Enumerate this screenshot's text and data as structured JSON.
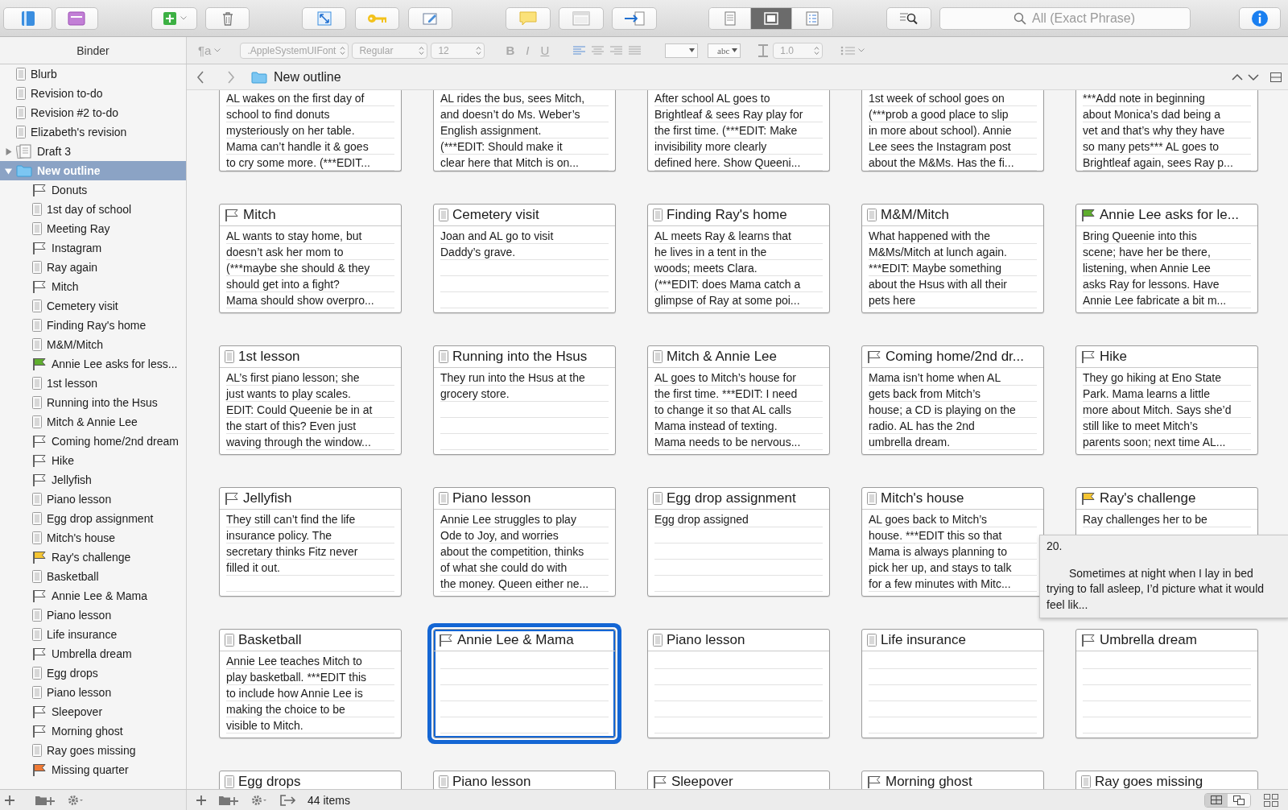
{
  "toolbar": {
    "view_modes": [
      {
        "selected": false
      },
      {
        "selected": true
      },
      {
        "selected": false
      }
    ],
    "search": {
      "placeholder": "All (Exact Phrase)"
    }
  },
  "format_bar": {
    "paragraph_style": "¶a",
    "font": ".AppleSystemUIFont",
    "typeface": "Regular",
    "size": "12",
    "bold": "B",
    "italic": "I",
    "underline": "U",
    "highlight": "abc",
    "line_spacing": "1.0"
  },
  "binder": {
    "title": "Binder",
    "items": [
      {
        "label": "Blurb",
        "kind": "doc",
        "selected": false
      },
      {
        "label": "Revision to-do",
        "kind": "doc",
        "selected": false
      },
      {
        "label": "Revision #2 to-do",
        "kind": "doc",
        "selected": false
      },
      {
        "label": "Elizabeth's revision",
        "kind": "doc",
        "selected": false
      },
      {
        "label": "Draft 3",
        "kind": "draft",
        "selected": false,
        "expanded": false
      },
      {
        "label": "New outline",
        "kind": "folder",
        "selected": true,
        "expanded": true,
        "children": [
          {
            "label": "Donuts",
            "kind": "flag",
            "selected": false
          },
          {
            "label": "1st day of school",
            "kind": "doc",
            "selected": false
          },
          {
            "label": "Meeting Ray",
            "kind": "doc",
            "selected": false
          },
          {
            "label": "Instagram",
            "kind": "flag",
            "selected": false
          },
          {
            "label": "Ray again",
            "kind": "doc",
            "selected": false
          },
          {
            "label": "Mitch",
            "kind": "flag",
            "selected": false
          },
          {
            "label": "Cemetery visit",
            "kind": "doc",
            "selected": false
          },
          {
            "label": "Finding Ray's home",
            "kind": "doc",
            "selected": false
          },
          {
            "label": "M&M/Mitch",
            "kind": "doc",
            "selected": false
          },
          {
            "label": "Annie Lee asks for less...",
            "kind": "flag",
            "color": "#5fae2e",
            "selected": false
          },
          {
            "label": "1st lesson",
            "kind": "doc",
            "selected": false
          },
          {
            "label": "Running into the Hsus",
            "kind": "doc",
            "selected": false
          },
          {
            "label": "Mitch & Annie Lee",
            "kind": "doc",
            "selected": false
          },
          {
            "label": "Coming home/2nd dream",
            "kind": "flag",
            "selected": false
          },
          {
            "label": "Hike",
            "kind": "flag",
            "selected": false
          },
          {
            "label": "Jellyfish",
            "kind": "flag",
            "selected": false
          },
          {
            "label": "Piano lesson",
            "kind": "doc",
            "selected": false
          },
          {
            "label": "Egg drop assignment",
            "kind": "doc",
            "selected": false
          },
          {
            "label": "Mitch's house",
            "kind": "doc",
            "selected": false
          },
          {
            "label": "Ray's challenge",
            "kind": "flag",
            "color": "#f5c533",
            "selected": false
          },
          {
            "label": "Basketball",
            "kind": "doc",
            "selected": false
          },
          {
            "label": "Annie Lee & Mama",
            "kind": "flag",
            "selected": false
          },
          {
            "label": "Piano lesson",
            "kind": "doc",
            "selected": false
          },
          {
            "label": "Life insurance",
            "kind": "doc",
            "selected": false
          },
          {
            "label": "Umbrella dream",
            "kind": "flag",
            "selected": false
          },
          {
            "label": "Egg drops",
            "kind": "doc",
            "selected": false
          },
          {
            "label": "Piano lesson",
            "kind": "doc",
            "selected": false
          },
          {
            "label": "Sleepover",
            "kind": "flag",
            "selected": false
          },
          {
            "label": "Morning ghost",
            "kind": "flag",
            "selected": false
          },
          {
            "label": "Ray goes missing",
            "kind": "doc",
            "selected": false
          },
          {
            "label": "Missing quarter",
            "kind": "flag",
            "color": "#f07a35",
            "selected": false
          }
        ]
      }
    ]
  },
  "header": {
    "title": "New outline"
  },
  "cards": [
    {
      "selected": false,
      "lines": [
        "AL wakes on the first day of",
        "school to find donuts",
        "mysteriously on her table.",
        "Mama can’t handle it & goes",
        "to cry some more. (***EDIT..."
      ]
    },
    {
      "selected": false,
      "lines": [
        "AL rides the bus, sees Mitch,",
        "and doesn’t do Ms. Weber’s",
        "English assignment.",
        "(***EDIT: Should make it",
        "clear here that Mitch is on..."
      ]
    },
    {
      "selected": false,
      "lines": [
        "After school AL goes to",
        "Brightleaf & sees Ray play for",
        "the first time. (***EDIT: Make",
        "invisibility more clearly",
        "defined here. Show Queeni..."
      ]
    },
    {
      "selected": false,
      "lines": [
        "1st week of school goes on",
        "(***prob a good place to slip",
        "in more about school). Annie",
        "Lee sees the Instagram post",
        "about the M&Ms. Has the fi..."
      ]
    },
    {
      "selected": false,
      "lines": [
        "***Add note in beginning",
        "about Monica’s dad being a",
        "vet and that’s why they have",
        "so many pets*** AL goes to",
        "Brightleaf again, sees Ray p..."
      ]
    },
    {
      "title": "Mitch",
      "kind": "flag",
      "selected": false,
      "lines": [
        "AL wants to stay home, but",
        "doesn’t ask her mom to",
        "(***maybe she should & they",
        "should get into a fight?",
        "Mama should show overpro..."
      ]
    },
    {
      "title": "Cemetery visit",
      "kind": "doc",
      "selected": false,
      "lines": [
        "Joan and AL go to visit",
        "Daddy’s grave."
      ]
    },
    {
      "title": "Finding Ray's home",
      "kind": "doc",
      "selected": false,
      "lines": [
        "AL meets Ray & learns that",
        "he lives in a tent in the",
        "woods; meets Clara.",
        "(***EDIT: does Mama catch a",
        "glimpse of Ray at some poi..."
      ]
    },
    {
      "title": "M&M/Mitch",
      "kind": "doc",
      "selected": false,
      "lines": [
        "What happened with the",
        "M&Ms/Mitch at lunch again.",
        "***EDIT: Maybe something",
        "about the Hsus with all their",
        "pets here"
      ]
    },
    {
      "title": "Annie Lee asks for le...",
      "kind": "flag",
      "color": "#5fae2e",
      "selected": false,
      "lines": [
        "Bring Queenie into this",
        "scene; have her be there,",
        "listening, when Annie Lee",
        "asks Ray for lessons. Have",
        "Annie Lee fabricate a bit m..."
      ]
    },
    {
      "title": "1st lesson",
      "kind": "doc",
      "selected": false,
      "lines": [
        "AL’s first piano lesson; she",
        "just wants to play scales.",
        "EDIT: Could Queenie be in at",
        "the start of this? Even just",
        "waving through the window..."
      ]
    },
    {
      "title": "Running into the Hsus",
      "kind": "doc",
      "selected": false,
      "lines": [
        "They run into the Hsus at the",
        "grocery store."
      ]
    },
    {
      "title": "Mitch & Annie Lee",
      "kind": "doc",
      "selected": false,
      "lines": [
        "AL goes to Mitch’s house for",
        "the first time. ***EDIT: I need",
        "to change it so that AL calls",
        "Mama instead of texting.",
        "Mama needs to be nervous..."
      ]
    },
    {
      "title": "Coming home/2nd dr...",
      "kind": "flag",
      "selected": false,
      "lines": [
        "Mama isn’t home when AL",
        "gets back from Mitch’s",
        "house; a CD is playing on the",
        "radio. AL has the 2nd",
        "umbrella dream."
      ]
    },
    {
      "title": "Hike",
      "kind": "flag",
      "selected": false,
      "lines": [
        "They go hiking at Eno State",
        "Park. Mama learns a little",
        "more about Mitch. Says she’d",
        "still like to meet Mitch’s",
        "parents soon; next time AL..."
      ]
    },
    {
      "title": "Jellyfish",
      "kind": "flag",
      "selected": false,
      "lines": [
        "They still can’t find the life",
        "insurance policy. The",
        "secretary thinks Fitz never",
        "filled it out."
      ]
    },
    {
      "title": "Piano lesson",
      "kind": "doc",
      "selected": false,
      "lines": [
        "Annie Lee struggles to play",
        "Ode to Joy, and worries",
        "about the competition, thinks",
        "of what she could do with",
        "the money. Queen either ne..."
      ]
    },
    {
      "title": "Egg drop assignment",
      "kind": "doc",
      "selected": false,
      "lines": [
        "Egg drop assigned"
      ]
    },
    {
      "title": "Mitch's house",
      "kind": "doc",
      "selected": false,
      "lines": [
        "AL goes back to Mitch’s",
        "house. ***EDIT this so that",
        "Mama is always planning to",
        "pick her up, and stays to talk",
        "for a few minutes with Mitc..."
      ]
    },
    {
      "title": "Ray's challenge",
      "kind": "flag",
      "color": "#f5c533",
      "selected": false,
      "lines": [
        "Ray challenges her to be"
      ],
      "tooltip": {
        "heading": "20.",
        "text": "Sometimes at night when I lay in bed trying to fall asleep, I’d picture what it would feel lik..."
      }
    },
    {
      "title": "Basketball",
      "kind": "doc",
      "selected": false,
      "lines": [
        "Annie Lee teaches Mitch to",
        "play basketball. ***EDIT this",
        "to include how Annie Lee is",
        "making the choice to be",
        "visible to Mitch."
      ]
    },
    {
      "title": "Annie Lee & Mama",
      "kind": "flag",
      "selected": true
    },
    {
      "title": "Piano lesson",
      "kind": "doc",
      "selected": false
    },
    {
      "title": "Life insurance",
      "kind": "doc",
      "selected": false
    },
    {
      "title": "Umbrella dream",
      "kind": "flag",
      "selected": false
    },
    {
      "title": "Egg drops",
      "kind": "doc",
      "selected": false
    },
    {
      "title": "Piano lesson",
      "kind": "doc",
      "selected": false
    },
    {
      "title": "Sleepover",
      "kind": "flag",
      "selected": false
    },
    {
      "title": "Morning ghost",
      "kind": "flag",
      "selected": false
    },
    {
      "title": "Ray goes missing",
      "kind": "doc",
      "selected": false
    }
  ],
  "footer": {
    "count": "44 items",
    "layouts": [
      {
        "selected": true
      },
      {
        "selected": false
      }
    ]
  }
}
